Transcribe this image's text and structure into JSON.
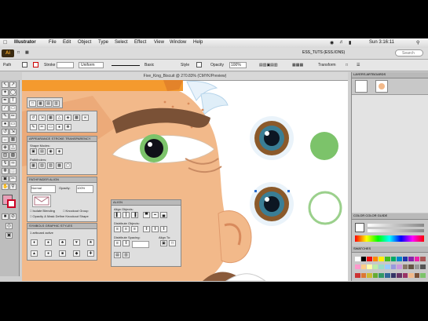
{
  "menubar": {
    "apple": "",
    "app": "Illustrator",
    "items": [
      "File",
      "Edit",
      "Object",
      "Type",
      "Select",
      "Effect",
      "View",
      "Window",
      "Help"
    ],
    "clock": "Sun 3:16:11"
  },
  "workspace": {
    "logo": "Ai",
    "name": "ESS_TUTS (ESS.IONS)",
    "search_placeholder": "Search"
  },
  "control": {
    "path_label": "Path",
    "stroke_label": "Stroke",
    "uniform_label": "Uniform",
    "basic_label": "Basic",
    "style_label": "Style",
    "opacity_label": "Opacity",
    "opacity_value": "100%",
    "transform_label": "Transform"
  },
  "document": {
    "title": "Five_King_Biscuit @ 270.83% (CMYK/Preview)"
  },
  "panels": {
    "appearance_title": "APPEARANCE  STROKE  TRANSPARENCY",
    "blend_mode": "Normal",
    "opacity_label": "Opacity:",
    "opacity_value": "100%",
    "isolate_label": "Isolate Blending",
    "knockout_label": "Knockout Group",
    "opacity_mask_label": "Opacity & Mask Define Knockout Shape",
    "pathfinder_title": "PATHFINDER  ALIGN",
    "shape_modes": "Shape Modes:",
    "pathfinders": "Pathfinders:",
    "expand": "Expand",
    "align_title": "ALIGN",
    "align_objects": "Align Objects:",
    "distribute_objects": "Distribute Objects:",
    "distribute_spacing": "Distribute Spacing:",
    "align_to": "Align To:",
    "symbols_title": "SYMBOLS  GRAPHIC STYLES",
    "symbols_sub": "1 artboard active"
  },
  "right_panels": {
    "layers_title": "LAYERS  ARTBOARDS",
    "color_title": "COLOR  COLOR GUIDE",
    "swatches_title": "SWATCHES"
  },
  "colors": {
    "skin": "#f2b98a",
    "skin_dark": "#e8946a",
    "eyebrow": "#7a5136",
    "iris_brown": "#8b5a2b",
    "iris_green": "#7cc36a",
    "sky_band": "#f49a2e"
  }
}
